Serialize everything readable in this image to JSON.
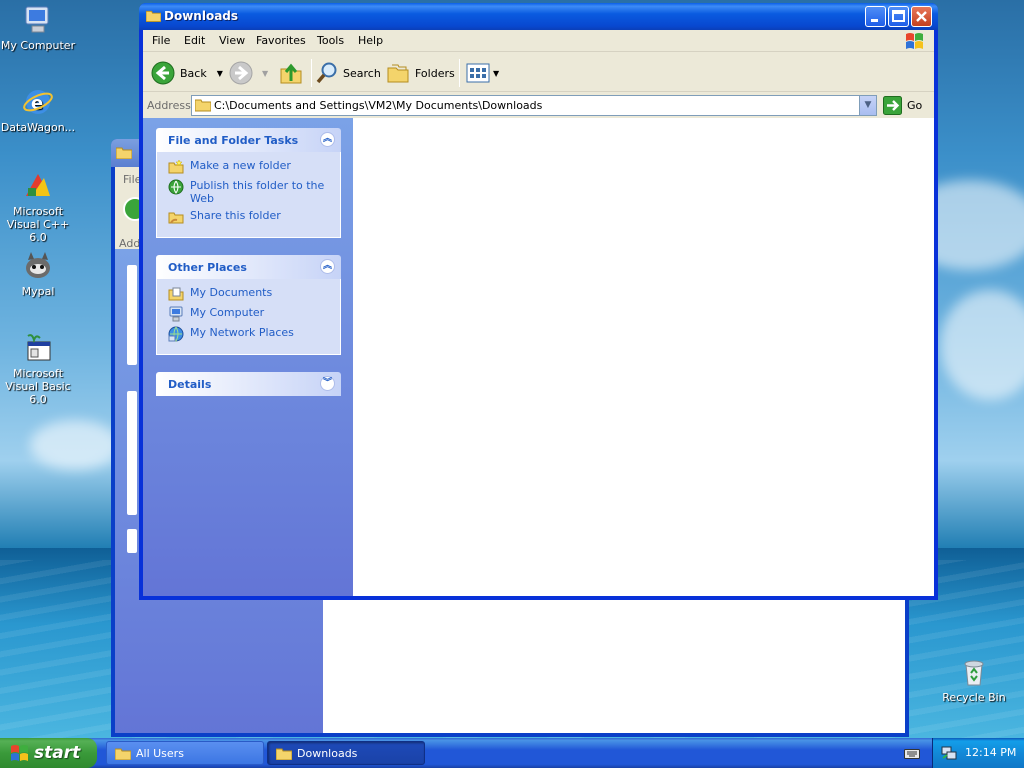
{
  "desktop": {
    "icons": [
      {
        "label": "My Computer",
        "icon": "my-computer-icon"
      },
      {
        "label": "DataWagon...",
        "icon": "internet-explorer-icon"
      },
      {
        "label": "Microsoft Visual C++ 6.0",
        "icon": "visual-cpp-icon"
      },
      {
        "label": "Mypal",
        "icon": "mypal-icon"
      },
      {
        "label": "Microsoft Visual Basic 6.0",
        "icon": "visual-basic-icon"
      },
      {
        "label": "Recycle Bin",
        "icon": "recycle-bin-icon"
      }
    ]
  },
  "background_window": {
    "menu_first": "File",
    "address_label": "Add"
  },
  "window": {
    "title": "Downloads",
    "menu": [
      "File",
      "Edit",
      "View",
      "Favorites",
      "Tools",
      "Help"
    ],
    "toolbar": {
      "back": "Back",
      "search": "Search",
      "folders": "Folders"
    },
    "address": {
      "label": "Address",
      "value": "C:\\Documents and Settings\\VM2\\My Documents\\Downloads",
      "go": "Go"
    },
    "task_panels": {
      "file_tasks": {
        "title": "File and Folder Tasks",
        "items": [
          "Make a new folder",
          "Publish this folder to the Web",
          "Share this folder"
        ]
      },
      "other_places": {
        "title": "Other Places",
        "items": [
          "My Documents",
          "My Computer",
          "My Network Places"
        ]
      },
      "details": {
        "title": "Details"
      }
    }
  },
  "taskbar": {
    "start": "start",
    "buttons": [
      "All Users",
      "Downloads"
    ],
    "clock": "12:14 PM"
  }
}
